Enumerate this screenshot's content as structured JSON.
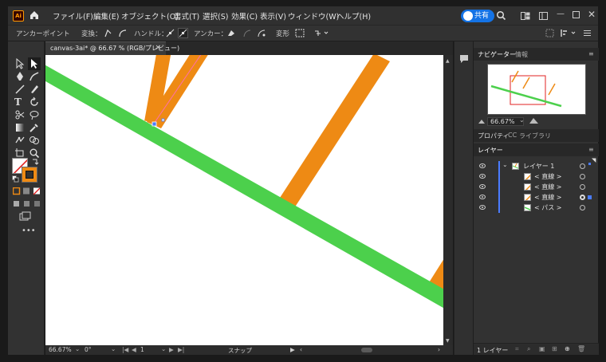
{
  "app": {
    "logo": "Ai",
    "menu": [
      "ファイル(F)",
      "編集(E)",
      "オブジェクト(O)",
      "書式(T)",
      "選択(S)",
      "効果(C)",
      "表示(V)",
      "ウィンドウ(W)",
      "ヘルプ(H)"
    ],
    "share_label": "共有",
    "window_controls": [
      "minimize-icon",
      "maximize-icon",
      "close-icon"
    ]
  },
  "control_bar": {
    "context_label": "アンカーポイント",
    "convert_label": "変換：",
    "handle_label": "ハンドル：",
    "anchor_label": "アンカー：",
    "transform_label": "変形"
  },
  "document": {
    "tab_title": "canvas-3ai* @ 66.67 % (RGB/プレビュー)",
    "close_glyph": "×"
  },
  "status_bar": {
    "zoom": "66.67%",
    "rotation": "0°",
    "artboard": "1",
    "snap_label": "スナップ"
  },
  "panels": {
    "navigator_tab": "ナビゲーター",
    "info_tab": "情報",
    "nav_zoom": "66.67%",
    "properties_tab": "プロパティ",
    "libraries_tab": "ライブラリ",
    "layers_tab": "レイヤー",
    "layers": [
      {
        "name": "レイヤー 1",
        "level": 0
      },
      {
        "name": "< 直線 >",
        "level": 1
      },
      {
        "name": "< 直線 >",
        "level": 1
      },
      {
        "name": "< 直線 >",
        "level": 1
      },
      {
        "name": "< パス >",
        "level": 1
      }
    ],
    "layer_count": "1 レイヤー"
  },
  "colors": {
    "green_stroke": "#4cd04c",
    "orange_stroke": "#ee8a14",
    "selection_blue": "#4a7cff",
    "accent": "#1473e6"
  }
}
